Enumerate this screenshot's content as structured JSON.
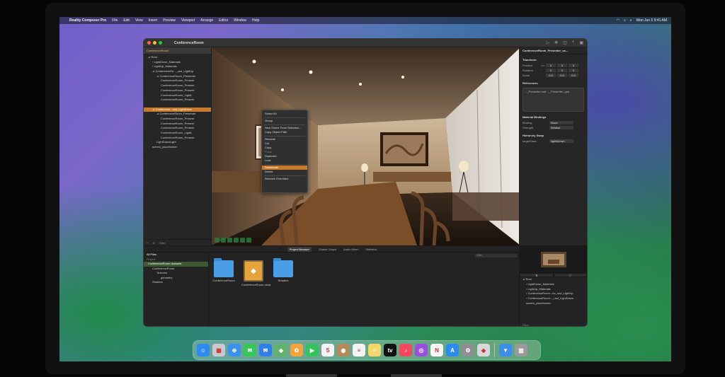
{
  "menubar": {
    "apple": "",
    "app_name": "Reality Composer Pro",
    "items": [
      "File",
      "Edit",
      "View",
      "Insert",
      "Preview",
      "Viewport",
      "Arrange",
      "Editor",
      "Window",
      "Help"
    ],
    "clock": "Mon Jun 5  9:41 AM"
  },
  "window": {
    "title": "ConferenceRoom",
    "tab": "ConferenceRoom"
  },
  "outliner": {
    "rows": [
      {
        "label": "⊿ Root",
        "indent": 1,
        "selected": false
      },
      {
        "label": "› LightDown_Materials",
        "indent": 2,
        "selected": false
      },
      {
        "label": "› LightUp_Materials",
        "indent": 2,
        "selected": false
      },
      {
        "label": "⊿ ConferenceRo..._usd_LightUp",
        "indent": 2,
        "selected": false
      },
      {
        "label": "⊿ ConferenceRoom_Presenter",
        "indent": 3,
        "selected": false
      },
      {
        "label": "ConferenceRoom_Present",
        "indent": 4,
        "selected": false
      },
      {
        "label": "ConferenceRoom_Present",
        "indent": 4,
        "selected": false
      },
      {
        "label": "ConferenceRoom_Present",
        "indent": 4,
        "selected": false
      },
      {
        "label": "ConferenceRoom_LightL",
        "indent": 4,
        "selected": false
      },
      {
        "label": "ConferenceRoom_Present",
        "indent": 4,
        "selected": false
      },
      {
        "label": "",
        "indent": 4,
        "selected": false
      },
      {
        "label": "⊿ Conference...usd_LightDown",
        "indent": 2,
        "selected": true
      },
      {
        "label": "⊿ ConferenceRoom_Presenter",
        "indent": 3,
        "selected": false
      },
      {
        "label": "ConferenceRoom_Present",
        "indent": 4,
        "selected": false
      },
      {
        "label": "ConferenceRoom_Present",
        "indent": 4,
        "selected": false
      },
      {
        "label": "ConferenceRoom_Present",
        "indent": 4,
        "selected": false
      },
      {
        "label": "ConferenceRoom_LightL",
        "indent": 4,
        "selected": false
      },
      {
        "label": "ConferenceRoom_Present",
        "indent": 4,
        "selected": false
      },
      {
        "label": "LightDownLight",
        "indent": 3,
        "selected": false
      },
      {
        "label": "screen_placeholder",
        "indent": 2,
        "selected": false
      }
    ],
    "filter_placeholder": "Filter"
  },
  "context_menu": {
    "items": [
      {
        "label": "Select All",
        "state": "normal"
      },
      {
        "sep": true
      },
      {
        "label": "Group",
        "state": "normal"
      },
      {
        "sep": true
      },
      {
        "label": "New Scene From Selection...",
        "state": "normal"
      },
      {
        "label": "Copy Object Path",
        "state": "normal"
      },
      {
        "sep": true
      },
      {
        "label": "Rename",
        "state": "normal"
      },
      {
        "label": "Cut",
        "state": "normal"
      },
      {
        "label": "Copy",
        "state": "normal"
      },
      {
        "label": "Paste",
        "state": "disabled"
      },
      {
        "label": "Duplicate",
        "state": "normal"
      },
      {
        "label": "Lock",
        "state": "normal"
      },
      {
        "sep": true
      },
      {
        "label": "Deactivate",
        "state": "highlighted"
      },
      {
        "label": "Delete",
        "state": "normal"
      },
      {
        "sep": true
      },
      {
        "label": "Remove Overrides",
        "state": "normal"
      }
    ]
  },
  "inspector": {
    "title": "ConferenceRoom_Presenter_us...",
    "transform": {
      "label": "Transform",
      "rows": [
        {
          "label": "Position",
          "unit": "cm",
          "x": "0",
          "y": "0",
          "z": "0"
        },
        {
          "label": "Rotation",
          "unit": "°",
          "x": "0",
          "y": "0",
          "z": "0"
        },
        {
          "label": "Scale",
          "unit": "",
          "x": "0.0",
          "y": "0.0",
          "z": "0.0"
        }
      ]
    },
    "references": {
      "label": "References",
      "value": "..._Presenter.usd  ..._Presenter_geo"
    },
    "material_bindings": {
      "label": "Material Bindings",
      "rows": [
        {
          "label": "Binding",
          "value": "None"
        },
        {
          "label": "Strength",
          "value": "Weaker"
        }
      ]
    },
    "hierarchy_swap": {
      "label": "Hierarchy Swap",
      "rows": [
        {
          "label": "targetState",
          "value": "lightsDown"
        }
      ]
    }
  },
  "bottom": {
    "tabs": [
      {
        "label": "Project Browser",
        "active": true
      },
      {
        "label": "Shader Graph",
        "active": false
      },
      {
        "label": "Audio Mixer",
        "active": false
      },
      {
        "label": "Statistics",
        "active": false
      }
    ],
    "filter_placeholder": "Filter",
    "all_files": "All Files",
    "project_label": "Project",
    "tree": [
      {
        "label": "ConferenceRoom.rkassets",
        "indent": 1,
        "selected": true
      },
      {
        "label": "ConferenceRoom",
        "indent": 2,
        "selected": false
      },
      {
        "label": "Textures",
        "indent": 3,
        "selected": false
      },
      {
        "label": "geometry",
        "indent": 4,
        "selected": false
      },
      {
        "label": "Shaders",
        "indent": 2,
        "selected": false
      }
    ],
    "files": [
      {
        "label": "ConferenceRoom",
        "kind": "folder"
      },
      {
        "label": "ConferenceRoom.usda",
        "kind": "usda"
      },
      {
        "label": "Shaders",
        "kind": "folder"
      }
    ]
  },
  "preview": {
    "tree": [
      "⊿ Root",
      "› LightDown_Materials",
      "› LightUp_Materials",
      "› ConferenceRoom...for_usd_LightUp",
      "› ConferenceRoom..._usd_LightDown",
      "screen_placeholder"
    ],
    "filter_placeholder": "Filter"
  },
  "dock": {
    "apps": [
      {
        "name": "finder-icon",
        "color": "#2d8bf0",
        "glyph": "☺"
      },
      {
        "name": "launchpad-icon",
        "color": "#c9c9d1",
        "glyph": "▦"
      },
      {
        "name": "safari-icon",
        "color": "#3a92f0",
        "glyph": "⊕"
      },
      {
        "name": "messages-icon",
        "color": "#35c759",
        "glyph": "✉"
      },
      {
        "name": "mail-icon",
        "color": "#2f7fe6",
        "glyph": "✉"
      },
      {
        "name": "maps-icon",
        "color": "#5fb46a",
        "glyph": "◈"
      },
      {
        "name": "photos-icon",
        "color": "#f2a33a",
        "glyph": "✿"
      },
      {
        "name": "facetime-icon",
        "color": "#34c35a",
        "glyph": "▶"
      },
      {
        "name": "calendar-icon",
        "color": "#f4f4f4",
        "glyph": "5"
      },
      {
        "name": "contacts-icon",
        "color": "#b48a5a",
        "glyph": "◉"
      },
      {
        "name": "reminders-icon",
        "color": "#f4f4f4",
        "glyph": "≡"
      },
      {
        "name": "notes-icon",
        "color": "#f5d66a",
        "glyph": "≡"
      },
      {
        "name": "apple-tv-icon",
        "color": "#111111",
        "glyph": "tv"
      },
      {
        "name": "music-icon",
        "color": "#f3485e",
        "glyph": "♪"
      },
      {
        "name": "podcasts-icon",
        "color": "#9a4fe0",
        "glyph": "◎"
      },
      {
        "name": "news-icon",
        "color": "#f5f5f5",
        "glyph": "N"
      },
      {
        "name": "app-store-icon",
        "color": "#2d8bf0",
        "glyph": "A"
      },
      {
        "name": "system-settings-icon",
        "color": "#8e8e93",
        "glyph": "⚙"
      },
      {
        "name": "reality-composer-icon",
        "color": "#d9d9d9",
        "glyph": "◆"
      },
      {
        "sep": true
      },
      {
        "name": "downloads-folder-icon",
        "color": "#3c8ee8",
        "glyph": "▼"
      },
      {
        "name": "trash-icon",
        "color": "#9a9a9a",
        "glyph": "▥"
      }
    ]
  }
}
